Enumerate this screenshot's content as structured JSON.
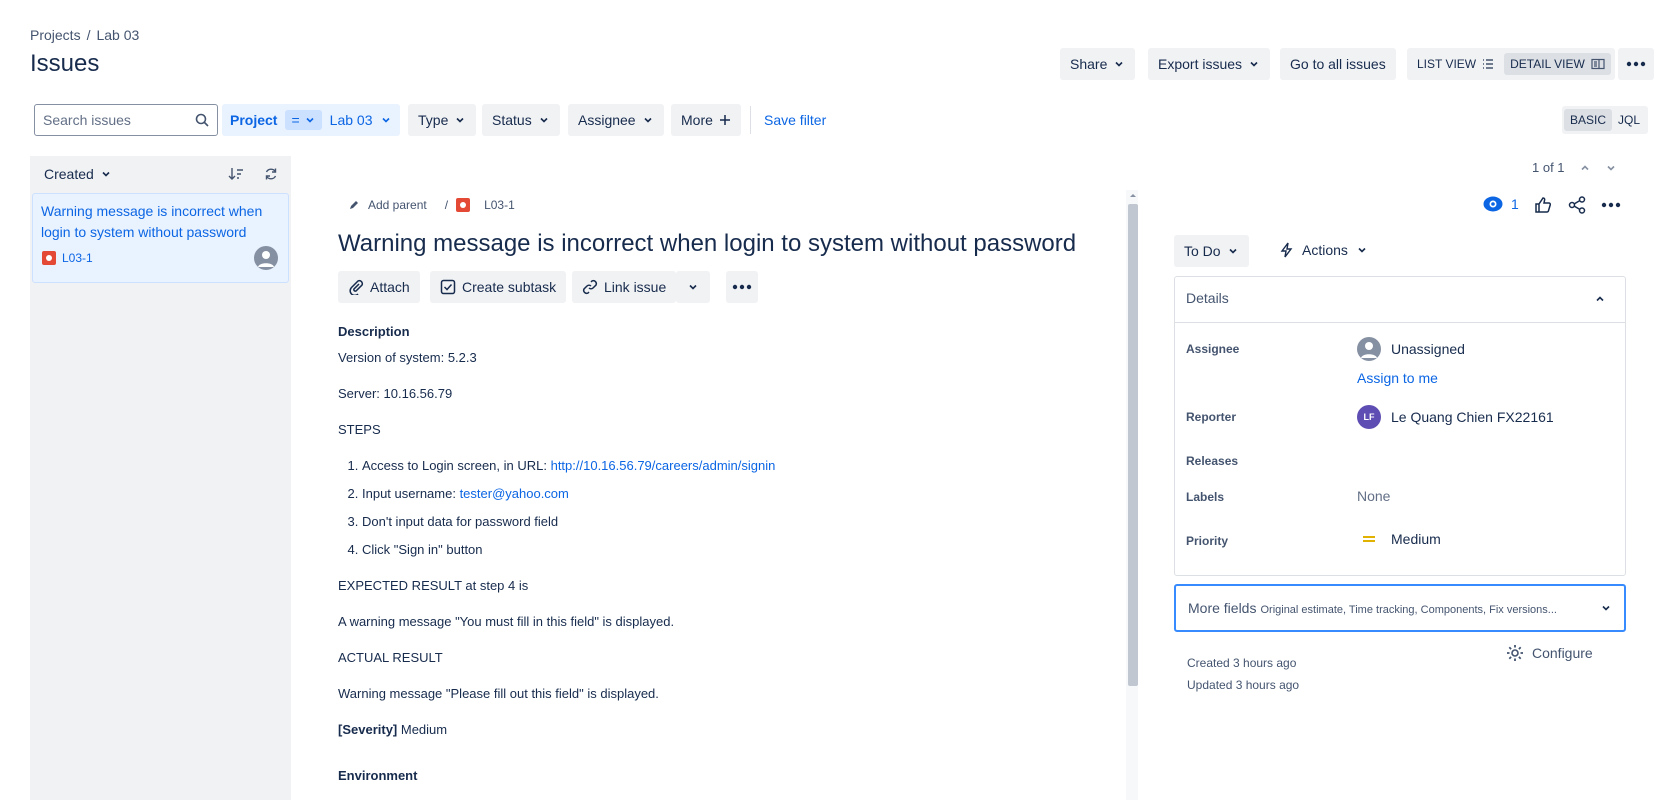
{
  "breadcrumbs": {
    "projects": "Projects",
    "sep": "/",
    "project": "Lab 03"
  },
  "page_title": "Issues",
  "header_actions": {
    "share": "Share",
    "export": "Export issues",
    "go_all": "Go to all issues",
    "list_view": "LIST VIEW",
    "detail_view": "DETAIL VIEW"
  },
  "filters": {
    "search_placeholder": "Search issues",
    "project_label": "Project",
    "project_operator": "=",
    "project_value": "Lab 03",
    "type": "Type",
    "status": "Status",
    "assignee": "Assignee",
    "more": "More",
    "save_filter": "Save filter",
    "basic": "BASIC",
    "jql": "JQL"
  },
  "list": {
    "sort_label": "Created",
    "items": [
      {
        "title": "Warning message is incorrect when login to system without password",
        "key": "L03-1"
      }
    ]
  },
  "pager": {
    "text": "1 of 1"
  },
  "issue": {
    "add_parent": "Add parent",
    "sep": "/",
    "key": "L03-1",
    "title": "Warning message is incorrect when login to system without password",
    "actions": {
      "attach": "Attach",
      "create_subtask": "Create subtask",
      "link_issue": "Link issue"
    },
    "description_heading": "Description",
    "version": "Version of system: 5.2.3",
    "server": "Server: 10.16.56.79",
    "steps_heading": "STEPS",
    "steps": {
      "s1_text": "Access to Login screen, in URL: ",
      "s1_link": "http://10.16.56.79/careers/admin/signin",
      "s2_text": "Input username: ",
      "s2_link": "tester@yahoo.com",
      "s3": "Don't input data for password field",
      "s4": "Click \"Sign in\" button"
    },
    "expected_heading": "EXPECTED RESULT at step 4 is",
    "expected": "A warning message \"You must fill in this field\" is displayed.",
    "actual_heading": "ACTUAL RESULT",
    "actual": "Warning message \"Please fill out this field\" is displayed.",
    "severity_label": "[Severity]",
    "severity_value": " Medium",
    "environment_heading": "Environment"
  },
  "side": {
    "watch_count": "1",
    "status": "To Do",
    "actions": "Actions",
    "details_heading": "Details",
    "assignee_label": "Assignee",
    "assignee_value": "Unassigned",
    "assign_to_me": "Assign to me",
    "reporter_label": "Reporter",
    "reporter_initials": "LF",
    "reporter_value": "Le Quang Chien FX22161",
    "releases_label": "Releases",
    "labels_label": "Labels",
    "labels_value": "None",
    "priority_label": "Priority",
    "priority_value": "Medium",
    "more_fields": "More fields",
    "more_fields_hint": "Original estimate, Time tracking, Components, Fix versions...",
    "created": "Created 3 hours ago",
    "updated": "Updated 3 hours ago",
    "configure": "Configure"
  },
  "colors": {
    "accent": "#0c66e4",
    "bug": "#e34935",
    "priority_medium": "#e2b203",
    "reporter_avatar": "#5e4db2"
  }
}
